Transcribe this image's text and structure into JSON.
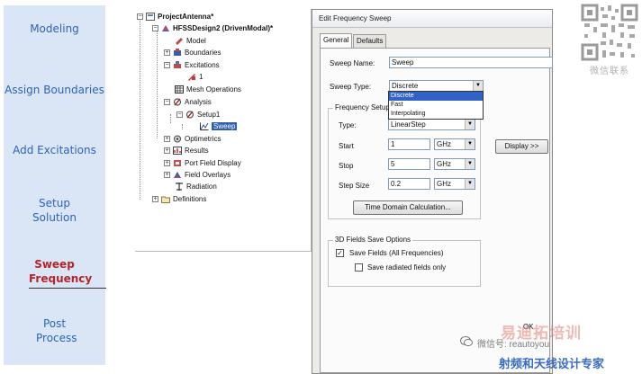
{
  "steps": [
    {
      "label": "Modeling",
      "active": false
    },
    {
      "label": "Assign Boundaries",
      "active": false
    },
    {
      "label": "Add Excitations",
      "active": false
    },
    {
      "label": "Setup Solution",
      "active": false
    },
    {
      "label": "Sweep Frequency",
      "active": true
    },
    {
      "label": "Post Process",
      "active": false
    }
  ],
  "tree": {
    "project": "ProjectAntenna*",
    "design": "HFSSDesign2 (DrivenModal)*",
    "model": "Model",
    "boundaries": "Boundaries",
    "excitations": "Excitations",
    "excitation_1": "1",
    "mesh_operations": "Mesh Operations",
    "analysis": "Analysis",
    "setup1": "Setup1",
    "sweep": "Sweep",
    "optimetrics": "Optimetrics",
    "results": "Results",
    "port_field_display": "Port Field Display",
    "field_overlays": "Field Overlays",
    "radiation": "Radiation",
    "definitions": "Definitions"
  },
  "dialog": {
    "title": "Edit Frequency Sweep",
    "tabs": [
      "General",
      "Defaults"
    ],
    "sweep_name_label": "Sweep Name:",
    "sweep_name_value": "Sweep",
    "sweep_type_label": "Sweep Type:",
    "sweep_type_value": "Discrete",
    "sweep_type_options": [
      "Discrete",
      "Fast",
      "Interpolating"
    ],
    "freq_setup_title": "Frequency Setup",
    "type_label": "Type:",
    "type_value": "LinearStep",
    "start_label": "Start",
    "start_value": "1",
    "start_unit": "GHz",
    "stop_label": "Stop",
    "stop_value": "5",
    "stop_unit": "GHz",
    "step_label": "Step Size",
    "step_value": "0.2",
    "step_unit": "GHz",
    "display_button": "Display >>",
    "time_domain_button": "Time Domain Calculation...",
    "fields_group_title": "3D Fields Save Options",
    "save_fields_label": "Save Fields (All Frequencies)",
    "save_fields_checked": true,
    "save_radiated_label": "Save radiated fields only",
    "save_radiated_checked": false,
    "ok_peek": "OK"
  },
  "watermark": {
    "qr_caption": "微信联系",
    "logo_text": "易迪拓培训",
    "wechat_text": "微信号: reautoyou",
    "sub_text": "射频和天线设计专家"
  }
}
